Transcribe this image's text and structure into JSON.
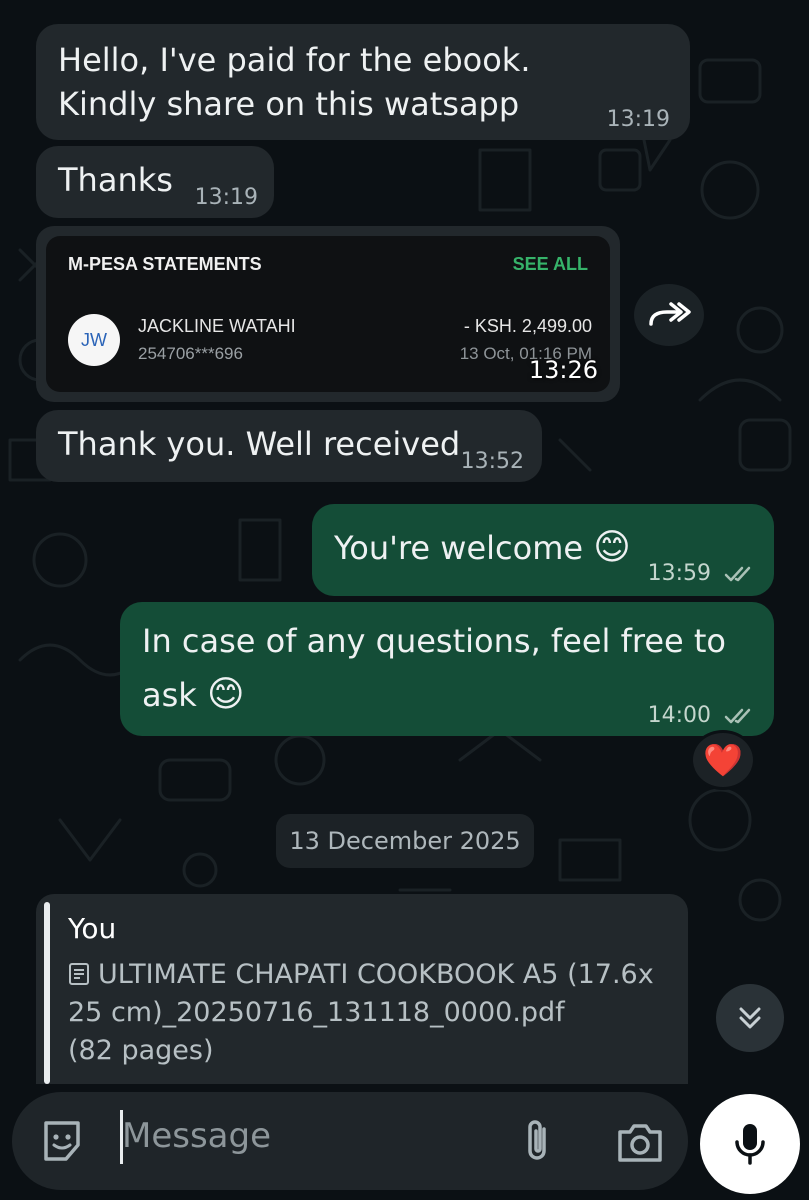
{
  "messages": [
    {
      "text": "Hello, I've paid for the ebook. Kindly share on this watsapp",
      "time": "13:19",
      "direction": "incoming"
    },
    {
      "text": "Thanks",
      "time": "13:19",
      "direction": "incoming"
    },
    {
      "text": "Thank you. Well received",
      "time": "13:52",
      "direction": "incoming"
    },
    {
      "text": "You're welcome",
      "emoji": "😊",
      "time": "13:59",
      "direction": "outgoing",
      "status": "read"
    },
    {
      "text": "In case of any questions, feel free to ask",
      "emoji": "😊",
      "time": "14:00",
      "direction": "outgoing",
      "status": "read"
    }
  ],
  "receipt": {
    "title": "M-PESA STATEMENTS",
    "see_all": "SEE ALL",
    "avatar_initials": "JW",
    "name": "JACKLINE WATAHI",
    "phone": "254706***696",
    "amount": "- KSH. 2,499.00",
    "date": "13 Oct, 01:16 PM",
    "time": "13:26"
  },
  "reaction": "❤️",
  "date_divider": "13 December 2025",
  "reply_preview": {
    "sender": "You",
    "file_icon": "document-icon",
    "file_text": "ULTIMATE CHAPATI COOKBOOK A5 (17.6x 25 cm)_20250716_131118_0000.pdf",
    "pages": "(82 pages)"
  },
  "composer": {
    "placeholder": "Message",
    "icons": [
      "sticker-icon",
      "attach-icon",
      "camera-icon",
      "mic-icon"
    ]
  },
  "colors": {
    "background": "#0b1014",
    "incoming_bubble": "#22282c",
    "outgoing_bubble": "#144d37",
    "read_ticks": "#a9c1b6",
    "see_all_green": "#36b36a"
  }
}
